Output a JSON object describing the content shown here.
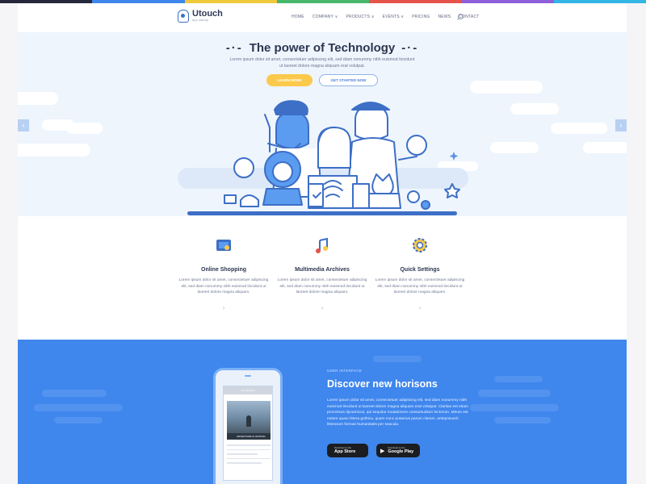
{
  "topbar_colors": [
    "#24283a",
    "#3f86ed",
    "#f0c93c",
    "#47b86b",
    "#e5534b",
    "#8e5fd8",
    "#33b5e5"
  ],
  "brand": {
    "name": "Utouch",
    "tagline": "app startup"
  },
  "nav": {
    "items": [
      "HOME",
      "COMPANY ∨",
      "PRODUCTS ∨",
      "EVENTS ∨",
      "PRICING",
      "NEWS",
      "CONTACT"
    ]
  },
  "hero": {
    "title": "The power of Technology",
    "text": "Lorem ipsum dolor sit amet, consectetuer adipiscing elit, sed diam nonummy nibh euismod tincidunt ut laoreet dolore magna aliquam erat volutpat.",
    "learn_more": "LEARN MORE",
    "get_started": "GET STARTED NOW",
    "prev_arrow": "‹",
    "next_arrow": "›"
  },
  "features": [
    {
      "title": "Online Shopping",
      "text": "Lorem ipsum dolor sit amet, consectetuer adipiscing elit, sed diam nonummy nibh euismod tincidunt ut laoreet dolore magna aliquam.",
      "more": "›",
      "icon": "shopping-icon"
    },
    {
      "title": "Multimedia Archives",
      "text": "Lorem ipsum dolor sit amet, consectetuer adipiscing elit, sed diam nonummy nibh euismod tincidunt ut laoreet dolore magna aliquam.",
      "more": "›",
      "icon": "music-note-icon"
    },
    {
      "title": "Quick Settings",
      "text": "Lorem ipsum dolor sit amet, consectetuer adipiscing elit, sed diam nonummy nibh euismod tincidunt ut laoreet dolore magna aliquam.",
      "more": "›",
      "icon": "gear-icon"
    }
  ],
  "blue_section": {
    "kicker": "USER INTERFACE",
    "title": "Discover new horisons",
    "text": "Lorem ipsum dolor sit amet, consectetuer adipiscing elit, sed diam nonummy nibh euismod tincidunt ut laoreet dolore magna aliquam erat volutpat. Claritas est etiam processus dynamicus, qui sequitur mutationem consuetudium lectorum. Mirum est notare quam littera gothica, quam nunc putamus parum claram, anteposuerit litterarum formas humanitatis per seacula.",
    "phone_header": "photographer",
    "phone_caption": "ADVENTURE IS WAITING",
    "app_store": {
      "small": "Download on the",
      "big": "App Store"
    },
    "google_play": {
      "small": "Download on the",
      "big": "Google Play"
    }
  }
}
